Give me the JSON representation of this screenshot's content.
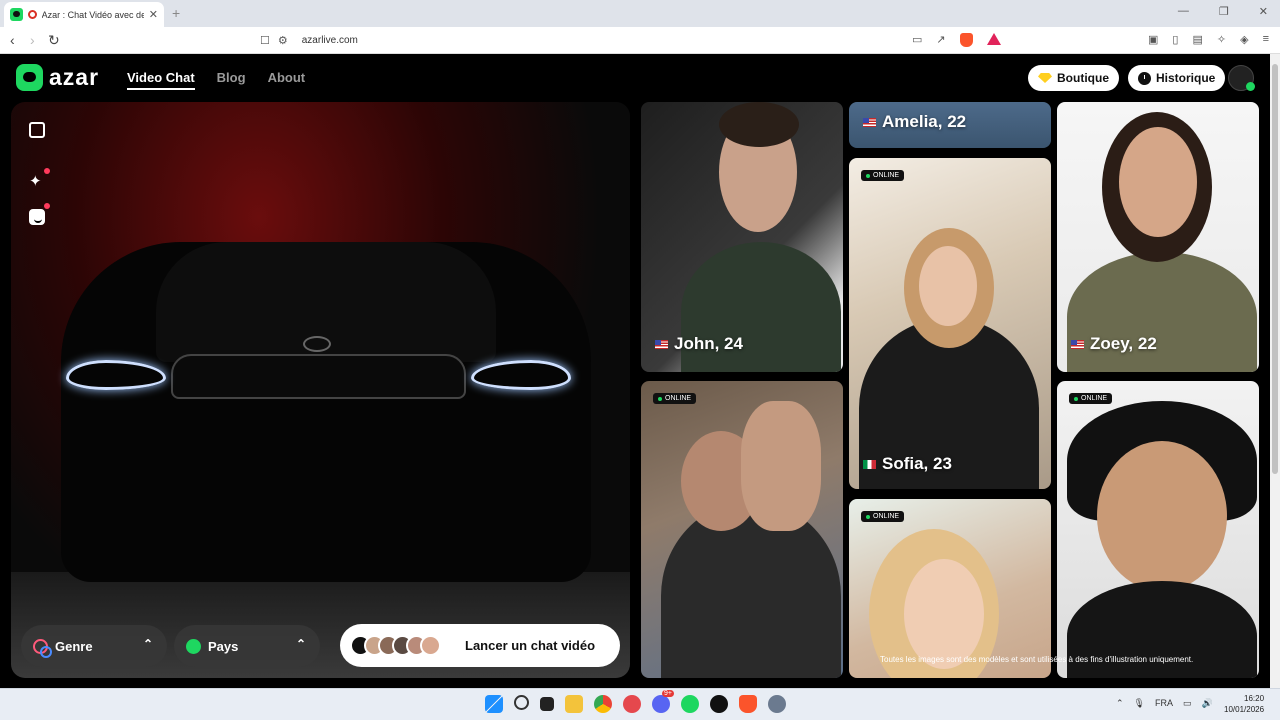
{
  "browser": {
    "tab_title": "Azar : Chat Vidéo avec de no",
    "close": "✕",
    "new_tab": "+",
    "url": "azarlive.com",
    "win_min": "—",
    "win_max": "❐",
    "win_close": "✕"
  },
  "header": {
    "logo": "azar",
    "nav": [
      "Video Chat",
      "Blog",
      "About"
    ],
    "shop_label": "Boutique",
    "history_label": "Historique",
    "accent": "#1ed760"
  },
  "video": {
    "gender_label": "Genre",
    "country_label": "Pays",
    "caret": "⌃",
    "start_label": "Lancer un chat vidéo"
  },
  "profiles": {
    "online": "ONLINE",
    "amelia": "Amelia, 22",
    "john": "John, 24",
    "sofia": "Sofia, 23",
    "zoey": "Zoey, 22",
    "disclaimer": "Toutes les images sont des modèles et sont utilisées à des fins d'illustration uniquement."
  },
  "taskbar": {
    "lang": "FRA",
    "time": "16:20",
    "date": "10/01/2026",
    "badge": "9+"
  }
}
